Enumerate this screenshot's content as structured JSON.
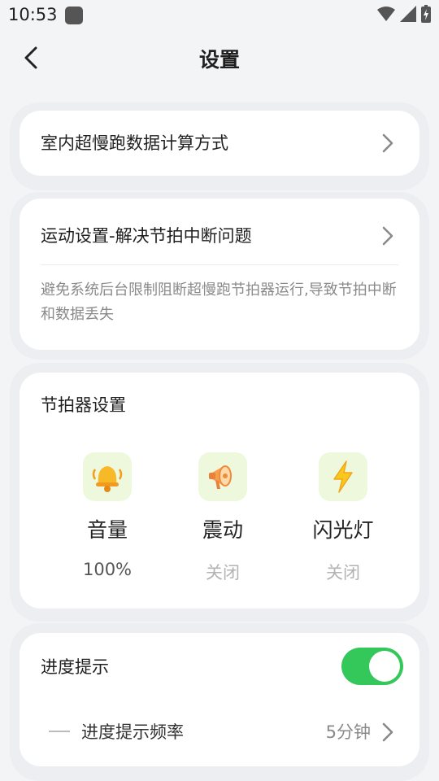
{
  "status_bar": {
    "time": "10:53"
  },
  "header": {
    "title": "设置"
  },
  "indoor": {
    "label": "室内超慢跑数据计算方式"
  },
  "motion": {
    "label": "运动设置-解决节拍中断问题",
    "description": "避免系统后台限制阻断超慢跑节拍器运行,导致节拍中断和数据丢失"
  },
  "metronome": {
    "title": "节拍器设置",
    "items": [
      {
        "label": "音量",
        "value": "100%",
        "icon": "bell-icon"
      },
      {
        "label": "震动",
        "value": "关闭",
        "icon": "megaphone-icon"
      },
      {
        "label": "闪光灯",
        "value": "关闭",
        "icon": "lightning-icon"
      }
    ]
  },
  "progress": {
    "label": "进度提示",
    "toggle_on": true,
    "frequency_label": "进度提示频率",
    "frequency_value": "5分钟"
  },
  "colors": {
    "toggle": "#34c759",
    "accent_bg": "#eef8dd"
  }
}
